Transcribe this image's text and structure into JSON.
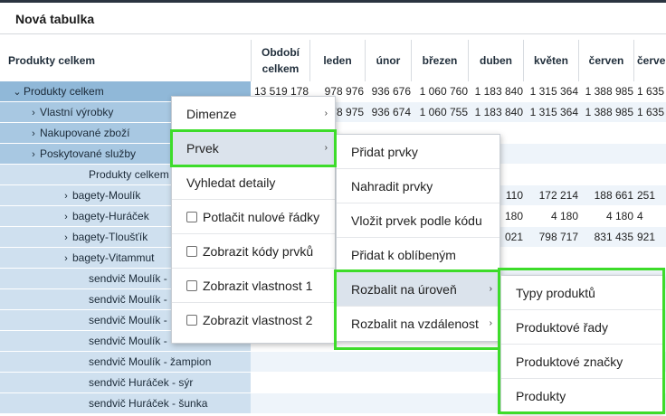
{
  "page": {
    "title": "Nová tabulka"
  },
  "table": {
    "row_header": "Produkty celkem",
    "columns": [
      "Období celkem",
      "leden",
      "únor",
      "březen",
      "duben",
      "květen",
      "červen",
      "červe"
    ],
    "rows": [
      {
        "label": "Produkty celkem",
        "caret": "⌄",
        "values": [
          "13 519 178",
          "978 976",
          "936 676",
          "1 060 760",
          "1 183 840",
          "1 315 364",
          "1 388 985",
          "1 635"
        ]
      },
      {
        "label": "Vlastní výrobky",
        "caret": "›",
        "values": [
          "",
          "978 975",
          "936 674",
          "1 060 755",
          "1 183 840",
          "1 315 364",
          "1 388 985",
          "1 635"
        ]
      },
      {
        "label": "Nakupované zboží",
        "caret": "›",
        "values": [
          "",
          "",
          "",
          "",
          "",
          "",
          "",
          ""
        ]
      },
      {
        "label": "Poskytované služby",
        "caret": "›",
        "values": [
          "",
          "",
          "",
          "",
          "",
          "",
          "",
          ""
        ]
      },
      {
        "label": "Produkty celkem",
        "caret": "",
        "values": [
          "",
          "",
          "",
          "",
          "",
          "",
          "",
          ""
        ]
      },
      {
        "label": "bagety-Moulík",
        "caret": "›",
        "values": [
          "",
          "",
          "",
          "",
          "110",
          "172 214",
          "188 661",
          "251"
        ]
      },
      {
        "label": "bagety-Huráček",
        "caret": "›",
        "values": [
          "",
          "",
          "",
          "",
          "180",
          "4 180",
          "4 180",
          "4"
        ]
      },
      {
        "label": "bagety-Tloušťík",
        "caret": "›",
        "values": [
          "",
          "",
          "",
          "",
          "021",
          "798 717",
          "831 435",
          "921"
        ]
      },
      {
        "label": "bagety-Vitammut",
        "caret": "›",
        "values": [
          "",
          "",
          "",
          "",
          "",
          "",
          "",
          ""
        ]
      },
      {
        "label": "sendvič Moulík -",
        "caret": "",
        "values": [
          "",
          "",
          "",
          "",
          "",
          "",
          "",
          ""
        ]
      },
      {
        "label": "sendvič Moulík -",
        "caret": "",
        "values": [
          "",
          "",
          "",
          "",
          "",
          "",
          "",
          ""
        ]
      },
      {
        "label": "sendvič Moulík -",
        "caret": "",
        "values": [
          "",
          "",
          "",
          "",
          "",
          "",
          "",
          ""
        ]
      },
      {
        "label": "sendvič Moulík -",
        "caret": "",
        "values": [
          "",
          "",
          "",
          "",
          "",
          "",
          "",
          ""
        ]
      },
      {
        "label": "sendvič Moulík - žampion",
        "caret": "",
        "values": [
          "",
          "",
          "",
          "",
          "",
          "",
          "",
          ""
        ]
      },
      {
        "label": "sendvič Huráček - sýr",
        "caret": "",
        "values": [
          "",
          "",
          "",
          "",
          "",
          "",
          "",
          ""
        ]
      },
      {
        "label": "sendvič Huráček - šunka",
        "caret": "",
        "values": [
          "",
          "",
          "",
          "",
          "",
          "",
          "",
          ""
        ]
      }
    ]
  },
  "context_menu": {
    "items": [
      {
        "label": "Dimenze",
        "arrow": "›"
      },
      {
        "label": "Prvek",
        "arrow": "›"
      },
      {
        "label": "Vyhledat detaily",
        "arrow": ""
      },
      {
        "label": "Potlačit nulové řádky",
        "arrow": ""
      },
      {
        "label": "Zobrazit kódy prvků",
        "arrow": ""
      },
      {
        "label": "Zobrazit vlastnost 1",
        "arrow": ""
      },
      {
        "label": "Zobrazit vlastnost 2",
        "arrow": ""
      }
    ]
  },
  "prvek_submenu": {
    "items": [
      {
        "label": "Přidat prvky",
        "arrow": ""
      },
      {
        "label": "Nahradit prvky",
        "arrow": ""
      },
      {
        "label": "Vložit prvek podle kódu",
        "arrow": ""
      },
      {
        "label": "Přidat k oblíbeným",
        "arrow": ""
      },
      {
        "label": "Rozbalit na úroveň",
        "arrow": "›"
      },
      {
        "label": "Rozbalit na vzdálenost",
        "arrow": "›"
      }
    ]
  },
  "level_submenu": {
    "items": [
      {
        "label": "Typy produktů"
      },
      {
        "label": "Produktové řady"
      },
      {
        "label": "Produktové značky"
      },
      {
        "label": "Produkty"
      }
    ]
  },
  "colors": {
    "highlight": "#3ddc2a",
    "row_header_bg": "#a8c8e2",
    "selected_item": "#dbe3ec"
  }
}
